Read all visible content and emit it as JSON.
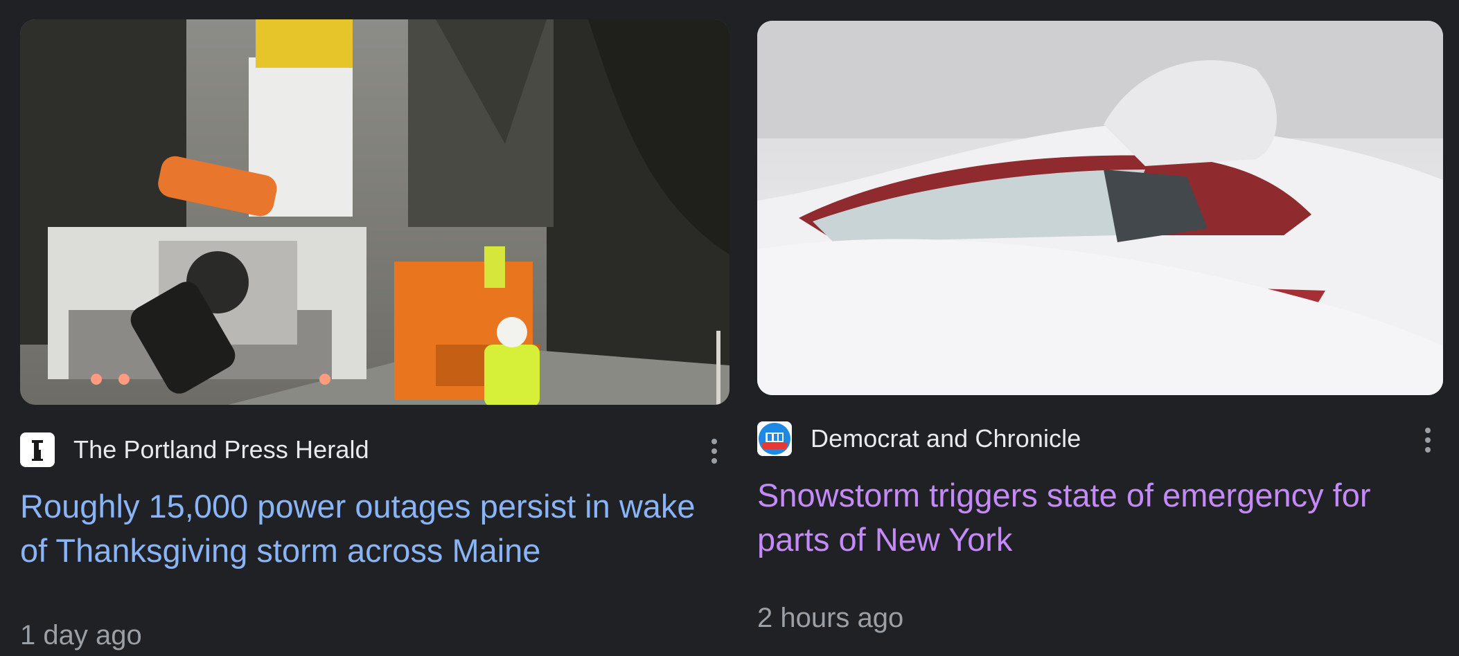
{
  "cards": [
    {
      "source": "The Portland Press Herald",
      "logo_icon": "portland-press-herald-logo",
      "headline": "Roughly 15,000 power outages persist in wake of Thanksgiving storm across Maine",
      "timestamp": "1 day ago",
      "image_subject": "utility-trucks-storm-repair"
    },
    {
      "source": "Democrat and Chronicle",
      "logo_icon": "democrat-and-chronicle-logo",
      "headline": "Snowstorm triggers state of emergency for parts of New York",
      "timestamp": "2 hours ago",
      "image_subject": "car-buried-in-snow"
    }
  ],
  "colors": {
    "background": "#202124",
    "visited_link": "#c58af9",
    "link": "#8ab4f8",
    "source_text": "#e8eaed",
    "meta_text": "#9aa0a6"
  },
  "icons": {
    "more": "more-vert-icon"
  }
}
